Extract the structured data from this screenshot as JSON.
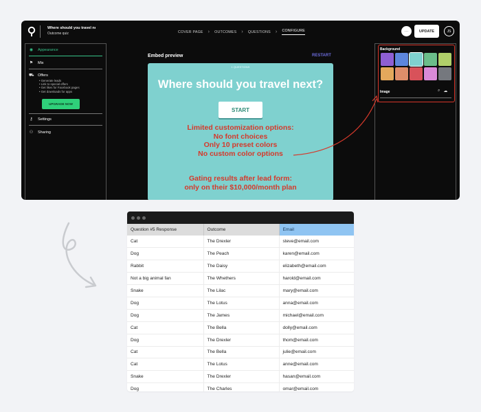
{
  "app": {
    "quiz_title": "Where should you travel ne...",
    "quiz_subtitle": "Outcome quiz",
    "steps": [
      "COVER PAGE",
      "OUTCOMES",
      "QUESTIONS",
      "CONFIGURE"
    ],
    "active_step": "CONFIGURE",
    "more_label": "···",
    "update_label": "UPDATE",
    "avatar_initials": "JS"
  },
  "left_panel": {
    "appearance": "Appearance",
    "mix": "Mix",
    "offers": "Offers",
    "offer_items": [
      "• Generate leads",
      "• Link to special offers",
      "• Get likes for Facebook pages",
      "• Get downloads for apps"
    ],
    "upgrade_label": "UPGRADE NOW",
    "settings": "Settings",
    "sharing": "Sharing"
  },
  "preview": {
    "embed_label": "Embed preview",
    "restart_label": "RESTART",
    "top_caption": "1 QUESTIONS",
    "question": "Where should you travel next?",
    "start_label": "START",
    "annotation_1": [
      "Limited customization options:",
      "No font choices",
      "Only 10 preset colors",
      "No custom color options"
    ],
    "annotation_2": [
      "Gating results after lead form:",
      "only on their $10,000/month plan"
    ],
    "bg_color": "#7fd1cf",
    "annotation_color": "#d5392b"
  },
  "right_panel": {
    "background_label": "Background",
    "swatches": [
      "#8e5fd3",
      "#5d86dc",
      "#7fd1cf",
      "#6bbd8a",
      "#b0cf6a",
      "#e3a85c",
      "#de8d6a",
      "#d8525a",
      "#d98ad8",
      "#75787e"
    ],
    "selected_swatch": 2,
    "image_label": "Image"
  },
  "sheet": {
    "columns": [
      "Question #5 Response",
      "Outcome",
      "Email"
    ],
    "rows": [
      [
        "Cat",
        "The Drexler",
        "steve@email.com"
      ],
      [
        "Dog",
        "The Peach",
        "karen@email.com"
      ],
      [
        "Rabbit",
        "The Daisy",
        "elizabeth@email.com"
      ],
      [
        "Not a big animal fan",
        "The Whethers",
        "harold@email.com"
      ],
      [
        "Snake",
        "The Lilac",
        "mary@email.com"
      ],
      [
        "Dog",
        "The Lotus",
        "anna@email.com"
      ],
      [
        "Dog",
        "The James",
        "michael@email.com"
      ],
      [
        "Cat",
        "The Bella",
        "dolly@email.com"
      ],
      [
        "Dog",
        "The Drexler",
        "thom@email.com"
      ],
      [
        "Cat",
        "The Bella",
        "julie@email.com"
      ],
      [
        "Cat",
        "The Lotus",
        "anne@email.com"
      ],
      [
        "Snake",
        "The Drexler",
        "hasan@email.com"
      ],
      [
        "Dog",
        "The Charles",
        "omar@email.com"
      ]
    ]
  }
}
